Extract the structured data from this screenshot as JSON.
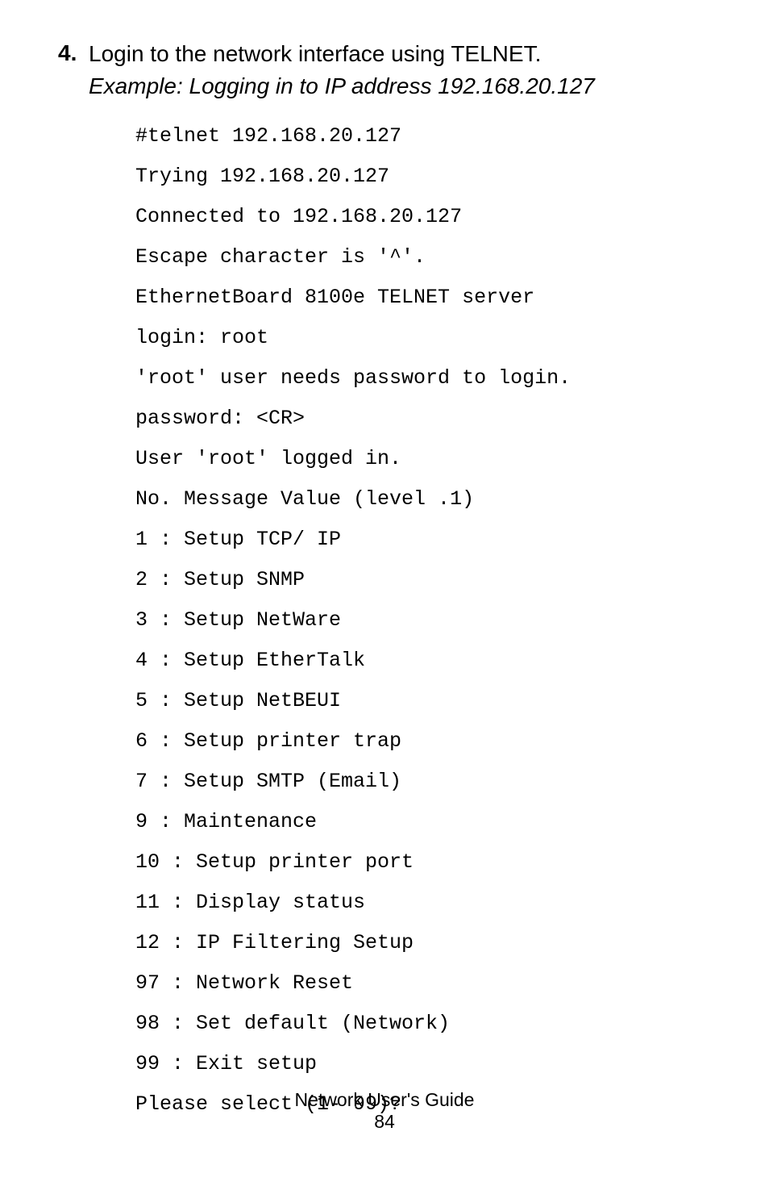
{
  "step": {
    "number": "4.",
    "text": "Login to the network interface using TELNET.",
    "italic": "Example: Logging in to IP address 192.168.20.127"
  },
  "code_lines": [
    "#telnet 192.168.20.127",
    "Trying 192.168.20.127",
    "Connected to 192.168.20.127",
    "Escape character is '^'.",
    "EthernetBoard 8100e TELNET server",
    "login: root",
    "'root' user needs password to login.",
    "password: <CR>",
    "User 'root' logged in.",
    "No. Message Value (level .1)",
    "1 : Setup TCP/ IP",
    "2 : Setup SNMP",
    "3 : Setup NetWare",
    "4 : Setup EtherTalk",
    "5 : Setup NetBEUI",
    "6 : Setup printer trap",
    "7 : Setup SMTP (Email)",
    "9 : Maintenance",
    "10 : Setup printer port",
    "11 : Display status",
    "12 : IP Filtering Setup",
    "97 : Network Reset",
    "98 : Set default (Network)",
    "99 : Exit setup",
    "Please select (1- 99)?"
  ],
  "footer": {
    "guide": "Network User's Guide",
    "page": "84"
  }
}
